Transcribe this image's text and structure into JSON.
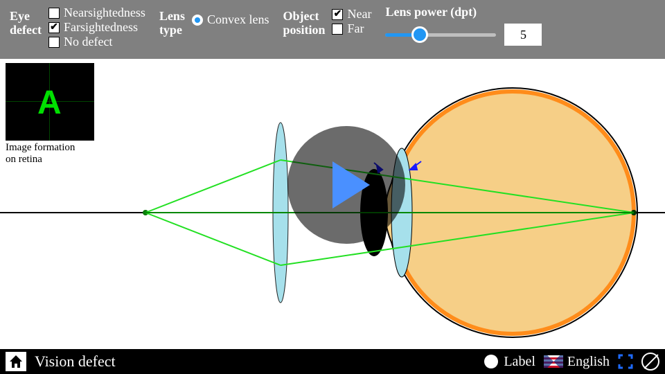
{
  "toolbar": {
    "eye_defect_label": "Eye\ndefect",
    "eye_defect_label1": "Eye",
    "eye_defect_label2": "defect",
    "options_eye": {
      "near": "Nearsightedness",
      "far": "Farsightedness",
      "none": "No defect"
    },
    "lens_type_label1": "Lens",
    "lens_type_label2": "type",
    "lens_type_value": "Convex lens",
    "object_position_label1": "Object",
    "object_position_label2": "position",
    "options_pos": {
      "near": "Near",
      "far": "Far"
    },
    "lens_power_label": "Lens power (dpt)",
    "lens_power_value": "5"
  },
  "inset": {
    "caption1": "Image formation",
    "caption2": "on retina",
    "letter": "A"
  },
  "bottom": {
    "title": "Vision defect",
    "label_toggle": "Label",
    "language": "English"
  }
}
